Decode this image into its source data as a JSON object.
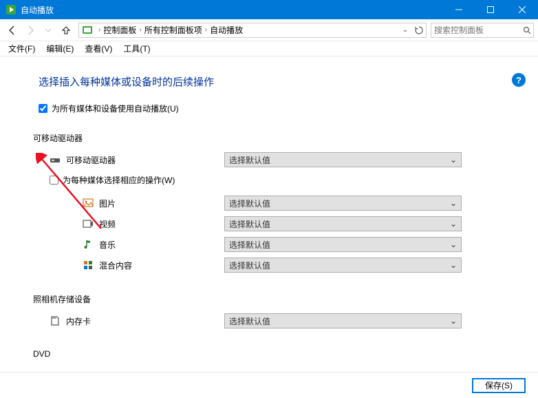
{
  "window": {
    "title": "自动播放"
  },
  "breadcrumbs": {
    "items": [
      "控制面板",
      "所有控制面板项",
      "自动播放"
    ]
  },
  "search": {
    "placeholder": "搜索控制面板"
  },
  "menu": {
    "file": "文件(F)",
    "edit": "编辑(E)",
    "view": "查看(V)",
    "tools": "工具(T)"
  },
  "page": {
    "heading": "选择插入每种媒体或设备时的后续操作",
    "all_media_label": "为所有媒体和设备使用自动播放(U)",
    "all_media_checked": true,
    "removable_section": "可移动驱动器",
    "removable_drive_label": "可移动驱动器",
    "removable_drive_value": "选择默认值",
    "each_media_label": "为每种媒体选择相应的操作(W)",
    "each_media_checked": false,
    "media": {
      "pictures": {
        "label": "图片",
        "value": "选择默认值"
      },
      "videos": {
        "label": "视频",
        "value": "选择默认值"
      },
      "music": {
        "label": "音乐",
        "value": "选择默认值"
      },
      "mixed": {
        "label": "混合内容",
        "value": "选择默认值"
      }
    },
    "camera_section": "照相机存储设备",
    "memory_card": {
      "label": "内存卡",
      "value": "选择默认值"
    },
    "dvd_section": "DVD",
    "save_button": "保存(S)",
    "help_tooltip": "?"
  }
}
